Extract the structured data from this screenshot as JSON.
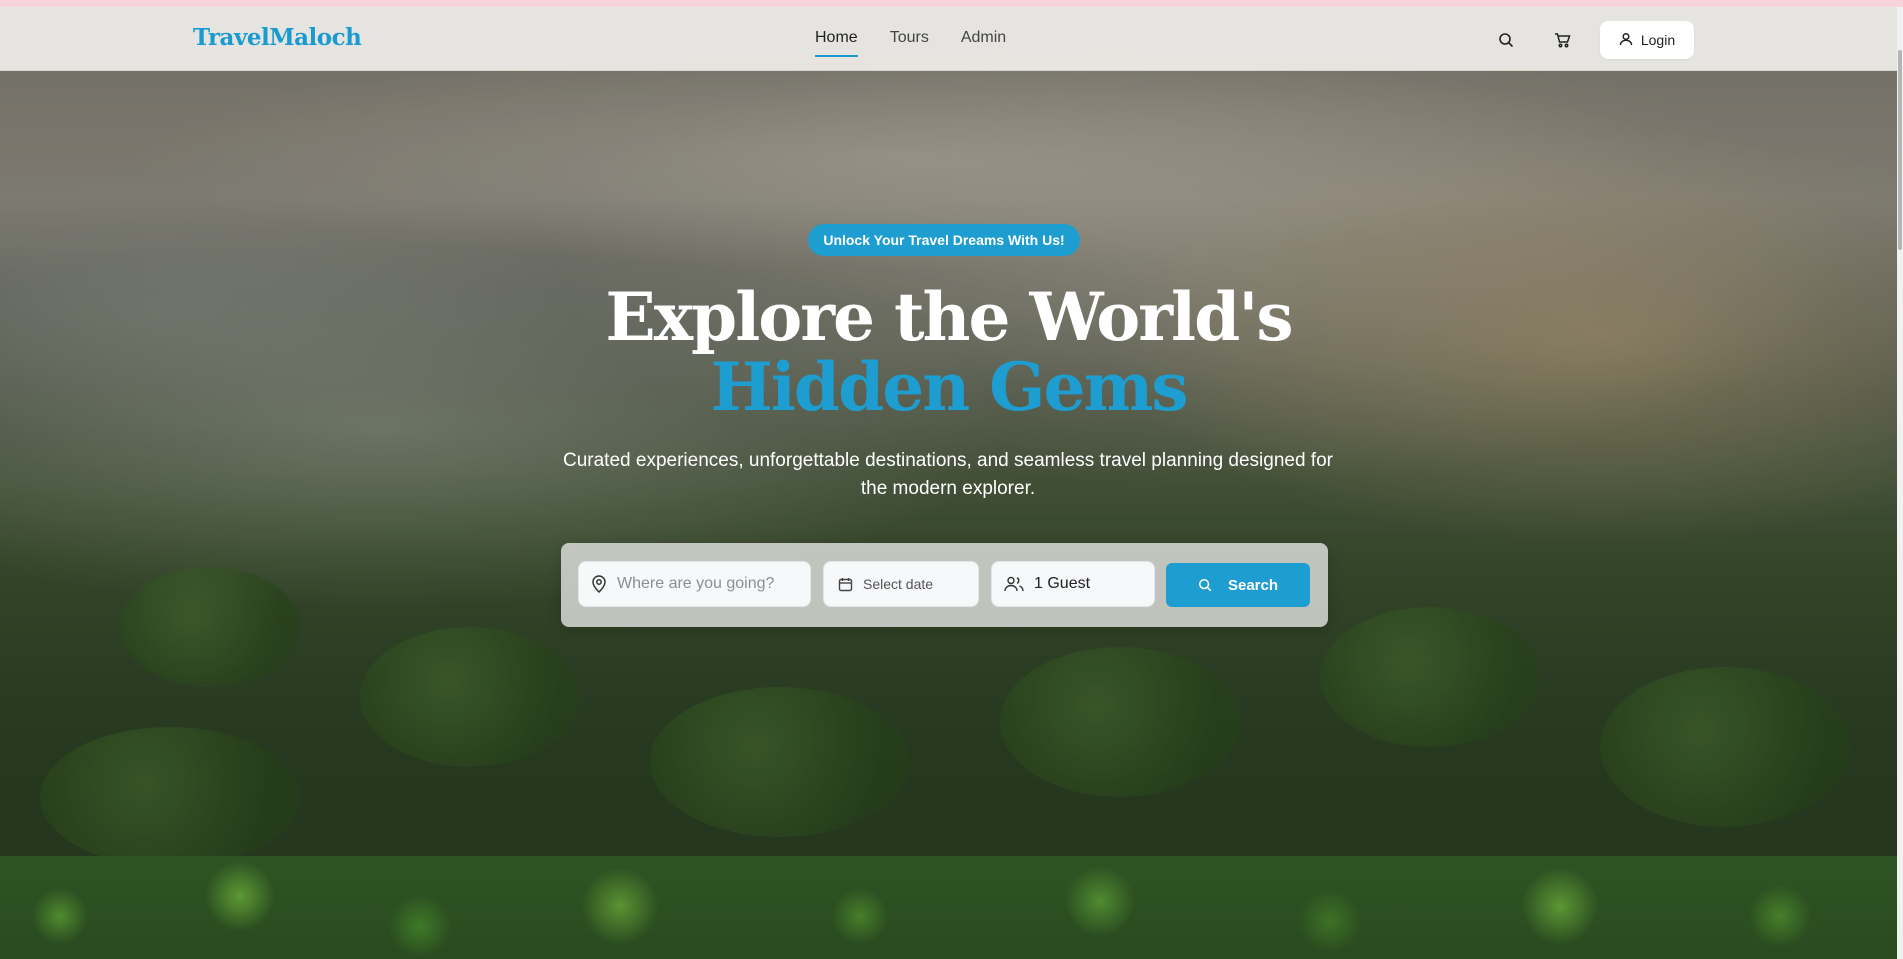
{
  "header": {
    "logo": "TravelMaloch",
    "nav": [
      {
        "label": "Home",
        "active": true
      },
      {
        "label": "Tours",
        "active": false
      },
      {
        "label": "Admin",
        "active": false
      }
    ],
    "icons": [
      "search-icon",
      "cart-icon"
    ],
    "login_label": "Login"
  },
  "hero": {
    "badge": "Unlock Your Travel Dreams With Us!",
    "title_line1": "Explore the World's",
    "title_line2": "Hidden Gems",
    "subtitle": "Curated experiences, unforgettable destinations, and seamless travel planning designed for the modern explorer."
  },
  "search": {
    "destination_placeholder": "Where are you going?",
    "date_label": "Select date",
    "guests_value": "1 Guest",
    "button_label": "Search"
  },
  "colors": {
    "accent": "#1e9dd1",
    "header_bg": "#ebe9e5"
  }
}
